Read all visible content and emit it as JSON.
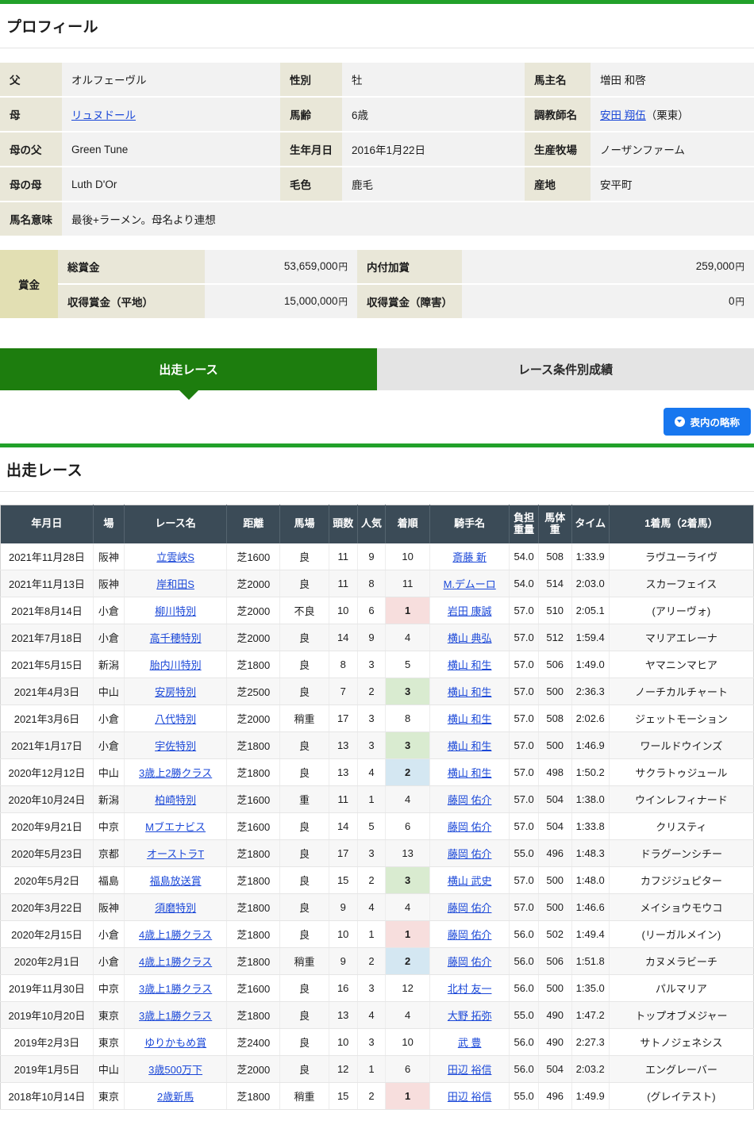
{
  "theme": {
    "accent_green": "#22a12a",
    "tab_active_green": "#1d7d0e",
    "header_slate": "#3b4b57",
    "button_blue": "#1877ef",
    "link_blue": "#1b48d8",
    "pos1_pink": "#f7dedd",
    "pos2_blue": "#d4e7f2",
    "pos3_green": "#d9ebd0"
  },
  "profile": {
    "heading": "プロフィール",
    "rows": [
      {
        "l1": "父",
        "v1": "オルフェーヴル",
        "v1_link": false,
        "l2": "性別",
        "v2": "牡",
        "l3": "馬主名",
        "v3": "増田 和啓",
        "v3_link": false,
        "v3_suffix": ""
      },
      {
        "l1": "母",
        "v1": "リュヌドール",
        "v1_link": true,
        "l2": "馬齢",
        "v2": "6歳",
        "l3": "調教師名",
        "v3": "安田 翔伍",
        "v3_link": true,
        "v3_suffix": "（栗東）"
      },
      {
        "l1": "母の父",
        "v1": "Green Tune",
        "v1_link": false,
        "l2": "生年月日",
        "v2": "2016年1月22日",
        "l3": "生産牧場",
        "v3": "ノーザンファーム",
        "v3_link": false,
        "v3_suffix": ""
      },
      {
        "l1": "母の母",
        "v1": "Luth D'Or",
        "v1_link": false,
        "l2": "毛色",
        "v2": "鹿毛",
        "l3": "産地",
        "v3": "安平町",
        "v3_link": false,
        "v3_suffix": ""
      }
    ],
    "meaning_label": "馬名意味",
    "meaning_value": "最後+ラーメン。母名より連想"
  },
  "prize": {
    "side_label": "賞金",
    "rows": [
      {
        "label_a": "総賞金",
        "value_a": "53,659,000",
        "unit_a": "円",
        "label_b": "内付加賞",
        "value_b": "259,000",
        "unit_b": "円"
      },
      {
        "label_a": "収得賞金（平地）",
        "value_a": "15,000,000",
        "unit_a": "円",
        "label_b": "収得賞金（障害）",
        "value_b": "0",
        "unit_b": "円"
      }
    ]
  },
  "tabs": [
    {
      "label": "出走レース",
      "active": true
    },
    {
      "label": "レース条件別成績",
      "active": false
    }
  ],
  "abbrev_button": {
    "label": "表内の略称"
  },
  "races": {
    "heading": "出走レース",
    "columns": [
      "年月日",
      "場",
      "レース名",
      "距離",
      "馬場",
      "頭数",
      "人気",
      "着順",
      "騎手名",
      "負担\n重量",
      "馬体重",
      "タイム",
      "1着馬（2着馬）"
    ],
    "columns_display": {
      "date": "年月日",
      "place": "場",
      "race_name": "レース名",
      "distance": "距離",
      "condition": "馬場",
      "head_count": "頭数",
      "popularity": "人気",
      "finish": "着順",
      "jockey": "騎手名",
      "weight_line1": "負担",
      "weight_line2": "重量",
      "horse_weight": "馬体重",
      "time": "タイム",
      "winner": "1着馬（2着馬）"
    },
    "rows": [
      {
        "date": "2021年11月28日",
        "place": "阪神",
        "name": "立雲峡S",
        "dist": "芝1600",
        "cond": "良",
        "heads": "11",
        "pop": "9",
        "fin": "10",
        "jockey": "斎藤 新",
        "wgt": "54.0",
        "bw": "508",
        "time": "1:33.9",
        "winner": "ラヴユーライヴ"
      },
      {
        "date": "2021年11月13日",
        "place": "阪神",
        "name": "岸和田S",
        "dist": "芝2000",
        "cond": "良",
        "heads": "11",
        "pop": "8",
        "fin": "11",
        "jockey": "M.デムーロ",
        "wgt": "54.0",
        "bw": "514",
        "time": "2:03.0",
        "winner": "スカーフェイス"
      },
      {
        "date": "2021年8月14日",
        "place": "小倉",
        "name": "柳川特別",
        "dist": "芝2000",
        "cond": "不良",
        "heads": "10",
        "pop": "6",
        "fin": "1",
        "jockey": "岩田 康誠",
        "wgt": "57.0",
        "bw": "510",
        "time": "2:05.1",
        "winner": "(アリーヴォ)"
      },
      {
        "date": "2021年7月18日",
        "place": "小倉",
        "name": "高千穂特別",
        "dist": "芝2000",
        "cond": "良",
        "heads": "14",
        "pop": "9",
        "fin": "4",
        "jockey": "横山 典弘",
        "wgt": "57.0",
        "bw": "512",
        "time": "1:59.4",
        "winner": "マリアエレーナ"
      },
      {
        "date": "2021年5月15日",
        "place": "新潟",
        "name": "胎内川特別",
        "dist": "芝1800",
        "cond": "良",
        "heads": "8",
        "pop": "3",
        "fin": "5",
        "jockey": "横山 和生",
        "wgt": "57.0",
        "bw": "506",
        "time": "1:49.0",
        "winner": "ヤマニンマヒア"
      },
      {
        "date": "2021年4月3日",
        "place": "中山",
        "name": "安房特別",
        "dist": "芝2500",
        "cond": "良",
        "heads": "7",
        "pop": "2",
        "fin": "3",
        "jockey": "横山 和生",
        "wgt": "57.0",
        "bw": "500",
        "time": "2:36.3",
        "winner": "ノーチカルチャート"
      },
      {
        "date": "2021年3月6日",
        "place": "小倉",
        "name": "八代特別",
        "dist": "芝2000",
        "cond": "稍重",
        "heads": "17",
        "pop": "3",
        "fin": "8",
        "jockey": "横山 和生",
        "wgt": "57.0",
        "bw": "508",
        "time": "2:02.6",
        "winner": "ジェットモーション"
      },
      {
        "date": "2021年1月17日",
        "place": "小倉",
        "name": "宇佐特別",
        "dist": "芝1800",
        "cond": "良",
        "heads": "13",
        "pop": "3",
        "fin": "3",
        "jockey": "横山 和生",
        "wgt": "57.0",
        "bw": "500",
        "time": "1:46.9",
        "winner": "ワールドウインズ"
      },
      {
        "date": "2020年12月12日",
        "place": "中山",
        "name": "3歳上2勝クラス",
        "dist": "芝1800",
        "cond": "良",
        "heads": "13",
        "pop": "4",
        "fin": "2",
        "jockey": "横山 和生",
        "wgt": "57.0",
        "bw": "498",
        "time": "1:50.2",
        "winner": "サクラトゥジュール"
      },
      {
        "date": "2020年10月24日",
        "place": "新潟",
        "name": "柏崎特別",
        "dist": "芝1600",
        "cond": "重",
        "heads": "11",
        "pop": "1",
        "fin": "4",
        "jockey": "藤岡 佑介",
        "wgt": "57.0",
        "bw": "504",
        "time": "1:38.0",
        "winner": "ウインレフィナード"
      },
      {
        "date": "2020年9月21日",
        "place": "中京",
        "name": "Mブエナビス",
        "dist": "芝1600",
        "cond": "良",
        "heads": "14",
        "pop": "5",
        "fin": "6",
        "jockey": "藤岡 佑介",
        "wgt": "57.0",
        "bw": "504",
        "time": "1:33.8",
        "winner": "クリスティ"
      },
      {
        "date": "2020年5月23日",
        "place": "京都",
        "name": "オーストラT",
        "dist": "芝1800",
        "cond": "良",
        "heads": "17",
        "pop": "3",
        "fin": "13",
        "jockey": "藤岡 佑介",
        "wgt": "55.0",
        "bw": "496",
        "time": "1:48.3",
        "winner": "ドラグーンシチー"
      },
      {
        "date": "2020年5月2日",
        "place": "福島",
        "name": "福島放送賞",
        "dist": "芝1800",
        "cond": "良",
        "heads": "15",
        "pop": "2",
        "fin": "3",
        "jockey": "横山 武史",
        "wgt": "57.0",
        "bw": "500",
        "time": "1:48.0",
        "winner": "カフジジュピター"
      },
      {
        "date": "2020年3月22日",
        "place": "阪神",
        "name": "須磨特別",
        "dist": "芝1800",
        "cond": "良",
        "heads": "9",
        "pop": "4",
        "fin": "4",
        "jockey": "藤岡 佑介",
        "wgt": "57.0",
        "bw": "500",
        "time": "1:46.6",
        "winner": "メイショウモウコ"
      },
      {
        "date": "2020年2月15日",
        "place": "小倉",
        "name": "4歳上1勝クラス",
        "dist": "芝1800",
        "cond": "良",
        "heads": "10",
        "pop": "1",
        "fin": "1",
        "jockey": "藤岡 佑介",
        "wgt": "56.0",
        "bw": "502",
        "time": "1:49.4",
        "winner": "(リーガルメイン)"
      },
      {
        "date": "2020年2月1日",
        "place": "小倉",
        "name": "4歳上1勝クラス",
        "dist": "芝1800",
        "cond": "稍重",
        "heads": "9",
        "pop": "2",
        "fin": "2",
        "jockey": "藤岡 佑介",
        "wgt": "56.0",
        "bw": "506",
        "time": "1:51.8",
        "winner": "カヌメラビーチ"
      },
      {
        "date": "2019年11月30日",
        "place": "中京",
        "name": "3歳上1勝クラス",
        "dist": "芝1600",
        "cond": "良",
        "heads": "16",
        "pop": "3",
        "fin": "12",
        "jockey": "北村 友一",
        "wgt": "56.0",
        "bw": "500",
        "time": "1:35.0",
        "winner": "パルマリア"
      },
      {
        "date": "2019年10月20日",
        "place": "東京",
        "name": "3歳上1勝クラス",
        "dist": "芝1800",
        "cond": "良",
        "heads": "13",
        "pop": "4",
        "fin": "4",
        "jockey": "大野 拓弥",
        "wgt": "55.0",
        "bw": "490",
        "time": "1:47.2",
        "winner": "トップオブメジャー"
      },
      {
        "date": "2019年2月3日",
        "place": "東京",
        "name": "ゆりかもめ賞",
        "dist": "芝2400",
        "cond": "良",
        "heads": "10",
        "pop": "3",
        "fin": "10",
        "jockey": "武 豊",
        "wgt": "56.0",
        "bw": "490",
        "time": "2:27.3",
        "winner": "サトノジェネシス"
      },
      {
        "date": "2019年1月5日",
        "place": "中山",
        "name": "3歳500万下",
        "dist": "芝2000",
        "cond": "良",
        "heads": "12",
        "pop": "1",
        "fin": "6",
        "jockey": "田辺 裕信",
        "wgt": "56.0",
        "bw": "504",
        "time": "2:03.2",
        "winner": "エングレーバー"
      },
      {
        "date": "2018年10月14日",
        "place": "東京",
        "name": "2歳新馬",
        "dist": "芝1800",
        "cond": "稍重",
        "heads": "15",
        "pop": "2",
        "fin": "1",
        "jockey": "田辺 裕信",
        "wgt": "55.0",
        "bw": "496",
        "time": "1:49.9",
        "winner": "(グレイテスト)"
      }
    ]
  }
}
